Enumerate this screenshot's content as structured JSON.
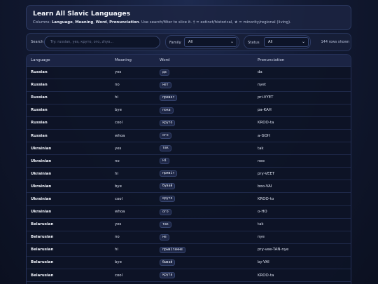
{
  "header": {
    "title": "Learn All Slavic Languages",
    "subtitle_prefix": "Columns: ",
    "col1": "Language",
    "col2": "Meaning",
    "col3": "Word",
    "col4": "Pronunciation",
    "subtitle_suffix": ". Use search/filter to slice it. † = extinct/historical, ★ = minority/regional (living)."
  },
  "controls": {
    "search_label": "Search",
    "search_placeholder": "Try: russian, yes, круто, ого, zhyo...",
    "family_label": "Family",
    "family_value": "All",
    "status_label": "Status",
    "status_value": "All",
    "rows_shown": "144 rows shown"
  },
  "table": {
    "headers": [
      "Language",
      "Meaning",
      "Word",
      "Pronunciation"
    ],
    "rows": [
      [
        "Russian",
        "yes",
        "да",
        "da"
      ],
      [
        "Russian",
        "no",
        "нет",
        "nyet"
      ],
      [
        "Russian",
        "hi",
        "привет",
        "pri-VYET"
      ],
      [
        "Russian",
        "bye",
        "пока",
        "pa-KAH"
      ],
      [
        "Russian",
        "cool",
        "круто",
        "KROO-ta"
      ],
      [
        "Russian",
        "whoa",
        "ого",
        "a-GOH"
      ],
      [
        "Ukrainian",
        "yes",
        "так",
        "tak"
      ],
      [
        "Ukrainian",
        "no",
        "ні",
        "nee"
      ],
      [
        "Ukrainian",
        "hi",
        "привіт",
        "pry-VEET"
      ],
      [
        "Ukrainian",
        "bye",
        "бувай",
        "boo-VAI"
      ],
      [
        "Ukrainian",
        "cool",
        "круто",
        "KROO-to"
      ],
      [
        "Ukrainian",
        "whoa",
        "ого",
        "o-HO"
      ],
      [
        "Belarusian",
        "yes",
        "так",
        "tak"
      ],
      [
        "Belarusian",
        "no",
        "не",
        "nye"
      ],
      [
        "Belarusian",
        "hi",
        "прывітанне",
        "pry-vee-TAN-nye"
      ],
      [
        "Belarusian",
        "bye",
        "бывай",
        "by-VAI"
      ],
      [
        "Belarusian",
        "cool",
        "крута",
        "KROO-ta"
      ]
    ]
  }
}
